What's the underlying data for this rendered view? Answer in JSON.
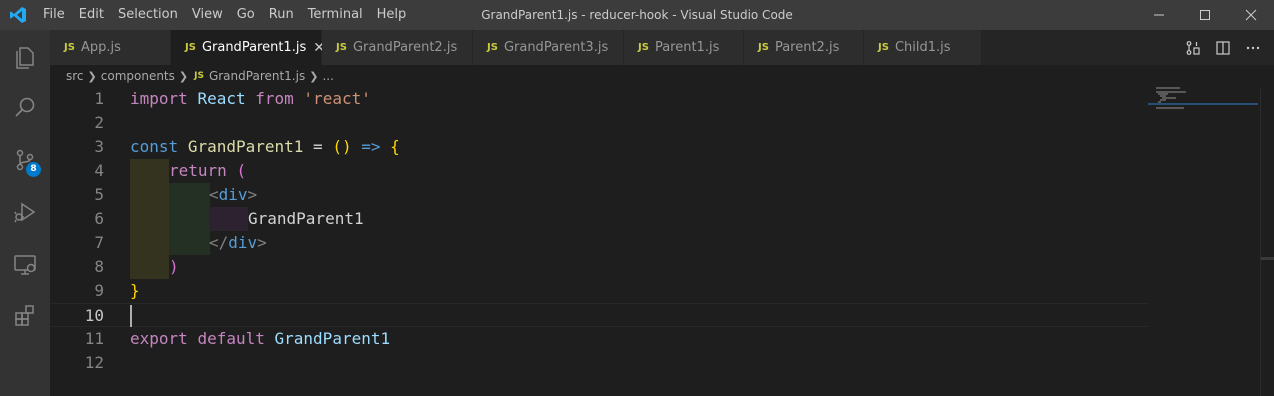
{
  "window": {
    "title": "GrandParent1.js - reducer-hook - Visual Studio Code",
    "controls": [
      "minimize-icon",
      "maximize-icon",
      "close-icon"
    ]
  },
  "menu": [
    "File",
    "Edit",
    "Selection",
    "View",
    "Go",
    "Run",
    "Terminal",
    "Help"
  ],
  "activity_bar": {
    "items": [
      "explorer-icon",
      "search-icon",
      "source-control-icon",
      "run-debug-icon",
      "remote-explorer-icon",
      "extensions-icon"
    ],
    "source_control_badge": "8"
  },
  "tabs": [
    {
      "label": "App.js",
      "badge": "JS",
      "active": false
    },
    {
      "label": "GrandParent1.js",
      "badge": "JS",
      "active": true,
      "close": "✕"
    },
    {
      "label": "GrandParent2.js",
      "badge": "JS",
      "active": false
    },
    {
      "label": "GrandParent3.js",
      "badge": "JS",
      "active": false
    },
    {
      "label": "Parent1.js",
      "badge": "JS",
      "active": false
    },
    {
      "label": "Parent2.js",
      "badge": "JS",
      "active": false
    },
    {
      "label": "Child1.js",
      "badge": "JS",
      "active": false
    }
  ],
  "tab_actions": [
    "open-changes-icon",
    "split-editor-icon",
    "more-actions-icon"
  ],
  "breadcrumb": {
    "parts": [
      "src",
      "components"
    ],
    "file_badge": "JS",
    "file": "GrandParent1.js",
    "ellipsis": "..."
  },
  "editor": {
    "line_numbers": [
      "1",
      "2",
      "3",
      "4",
      "5",
      "6",
      "7",
      "8",
      "9",
      "10",
      "11",
      "12"
    ],
    "current_line": "10",
    "code": {
      "l1": {
        "kw": "import",
        "name": "React",
        "from": "from",
        "str": "'react'"
      },
      "l3": {
        "decl": "const",
        "name": "GrandParent1",
        "eq": "=",
        "parens": "()",
        "arrow": "=>",
        "brace": "{"
      },
      "l4": {
        "kw": "return",
        "paren": "("
      },
      "l5": {
        "open": "<",
        "tag": "div",
        "close": ">"
      },
      "l6": {
        "text": "GrandParent1"
      },
      "l7": {
        "open": "</",
        "tag": "div",
        "close": ">"
      },
      "l8": {
        "paren": ")"
      },
      "l9": {
        "brace": "}"
      },
      "l11": {
        "kw1": "export",
        "kw2": "default",
        "name": "GrandParent1"
      }
    }
  },
  "colors": {
    "keyword": "#c586c0",
    "declaration": "#569cd6",
    "function_name": "#dcdcaa",
    "identifier": "#9cdcfe",
    "string": "#ce9178",
    "accent": "#007acc"
  }
}
